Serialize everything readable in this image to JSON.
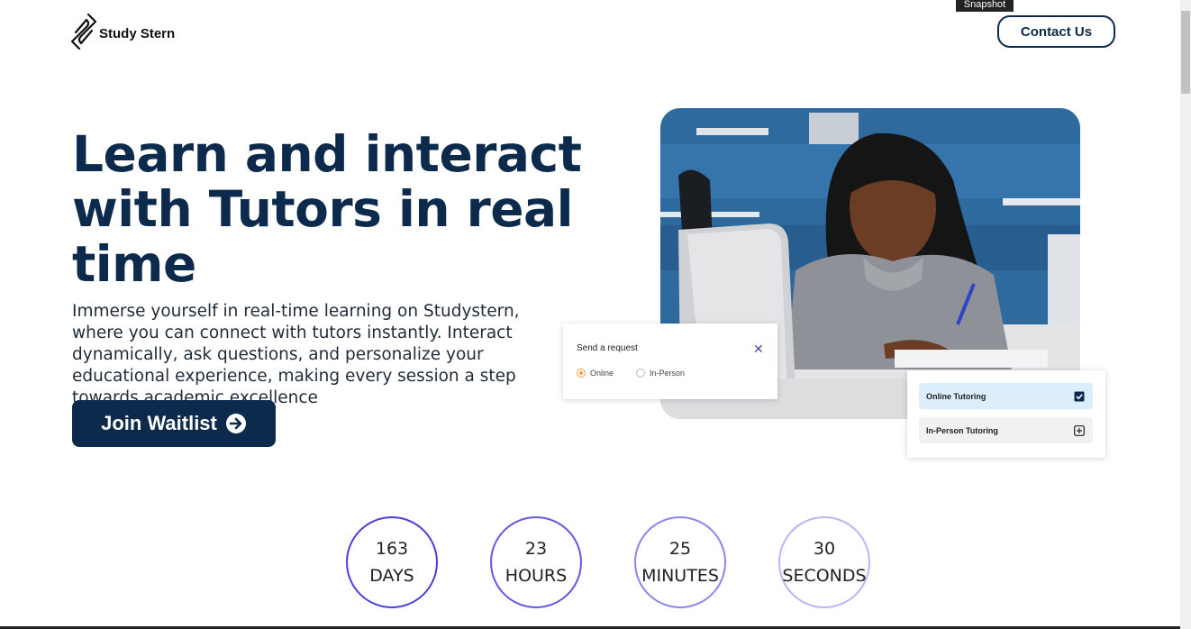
{
  "tooltip": "Snapshot",
  "brand": {
    "name": "Study Stern",
    "logo_icon": "paperclip-s-icon"
  },
  "header": {
    "contact_label": "Contact Us"
  },
  "hero": {
    "title": "Learn and interact with Tutors in real time",
    "description": "Immerse yourself in real-time learning on Studystern, where you can connect with tutors instantly. Interact dynamically, ask questions, and personalize your educational experience, making every session a step towards academic excellence",
    "cta_label": "Join Waitlist",
    "cta_icon": "arrow-right-circle-icon"
  },
  "request_card": {
    "title": "Send a request",
    "close_icon": "close-icon",
    "options": [
      {
        "label": "Online",
        "selected": true
      },
      {
        "label": "In-Person",
        "selected": false
      }
    ]
  },
  "tutor_card": {
    "options": [
      {
        "label": "Online Tutoring",
        "icon": "checkbox-checked-icon"
      },
      {
        "label": "In-Person Tutoring",
        "icon": "plus-square-icon"
      }
    ]
  },
  "countdown": [
    {
      "value": "163",
      "unit": "DAYS"
    },
    {
      "value": "23",
      "unit": "HOURS"
    },
    {
      "value": "25",
      "unit": "MINUTES"
    },
    {
      "value": "30",
      "unit": "SECONDS"
    }
  ],
  "colors": {
    "brand_navy": "#0c2a4b",
    "ring_1": "#4a3fe0",
    "ring_2": "#6457e6",
    "ring_3": "#8b85f0",
    "ring_4": "#b9b5f6",
    "radio_selected": "#f0a040",
    "online_option_bg": "#dceefc"
  }
}
